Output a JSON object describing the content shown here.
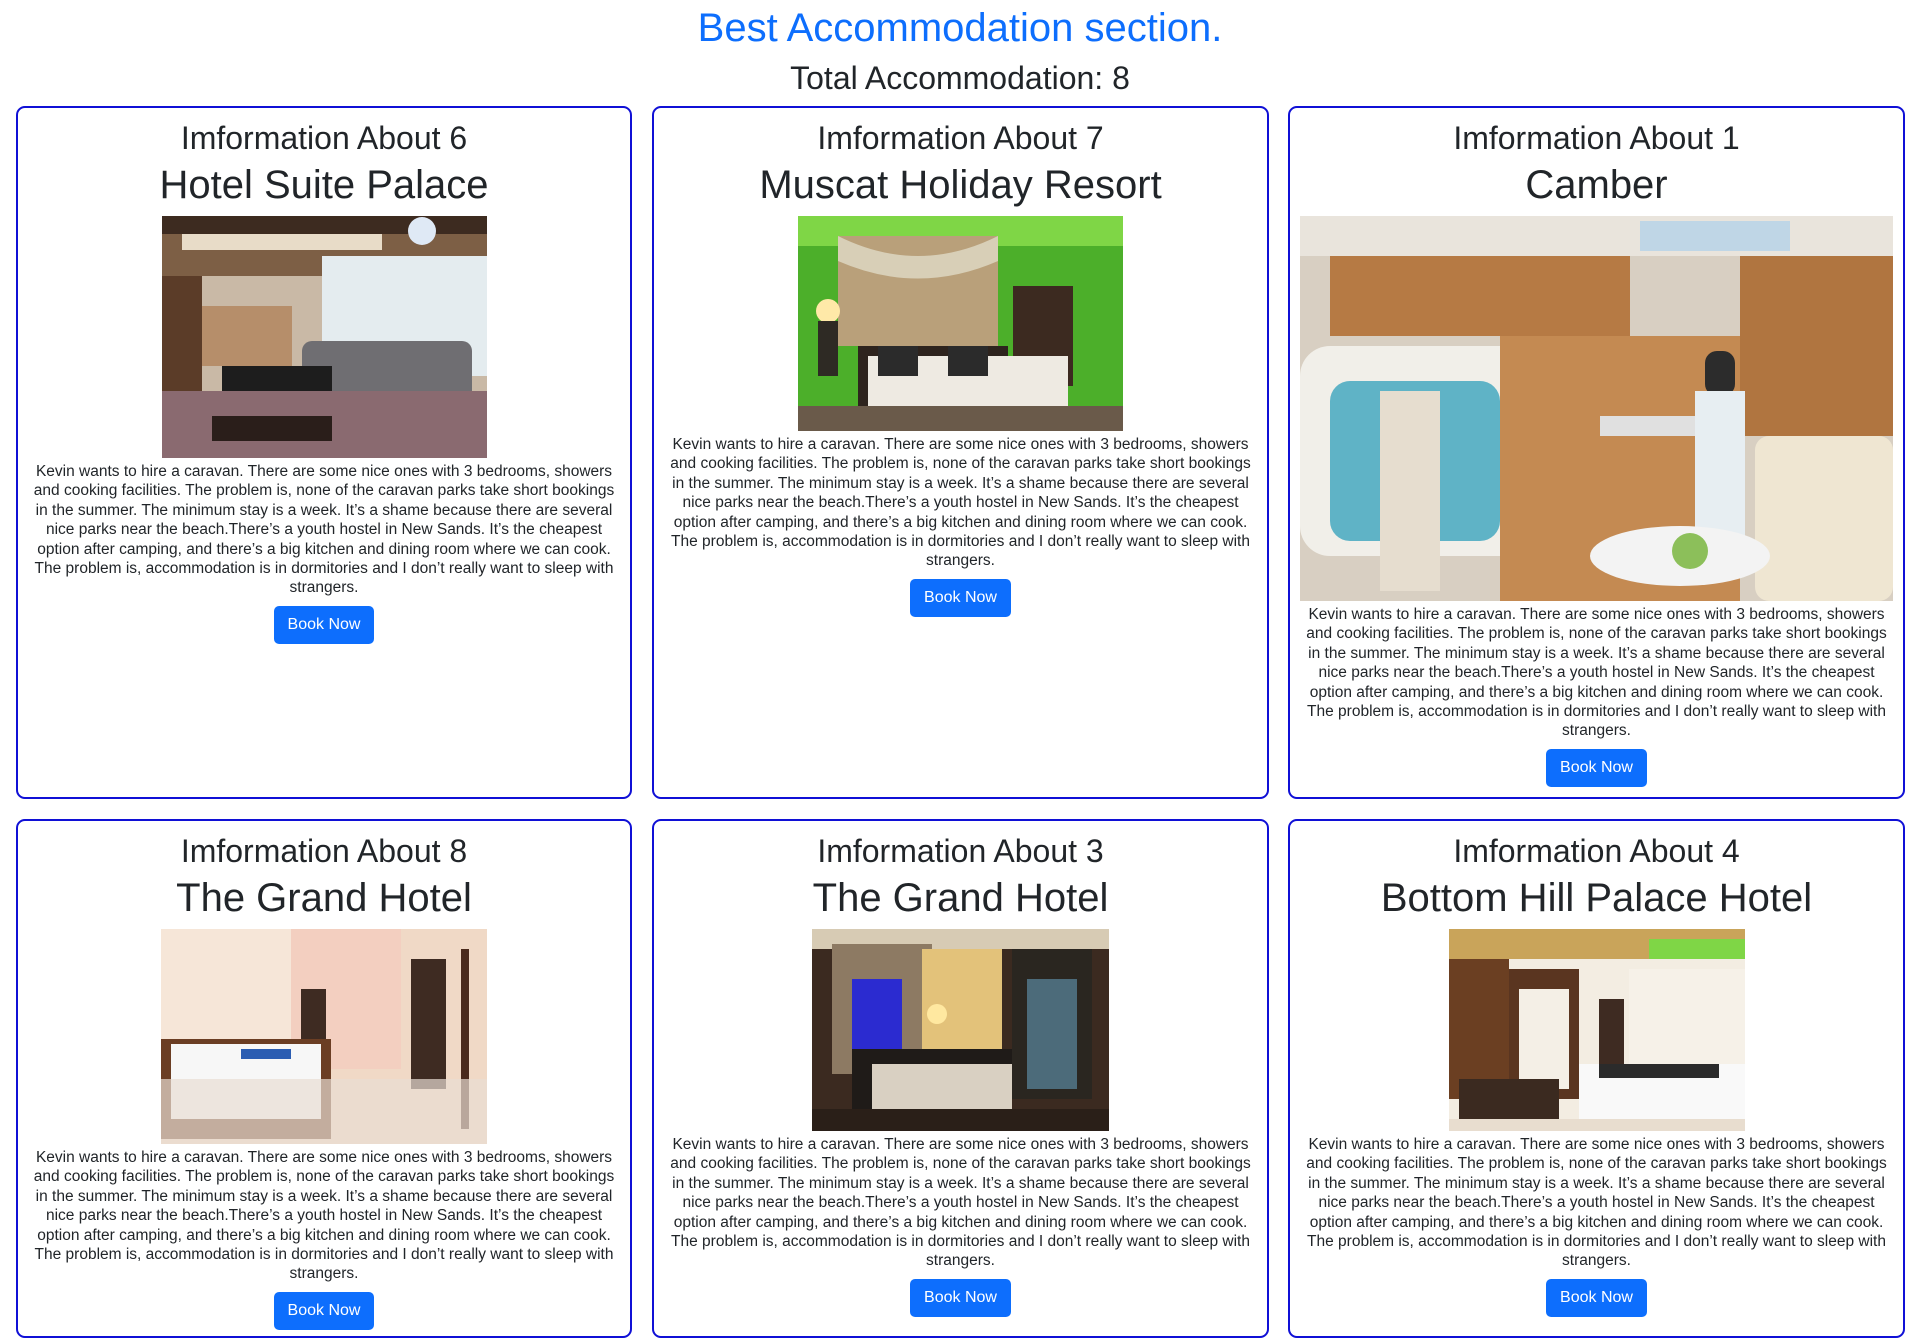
{
  "header": {
    "title": "Best Accommodation section.",
    "total": "Total Accommodation: 8"
  },
  "cards": [
    {
      "info": "Imformation About 6",
      "name": "Hotel Suite Palace",
      "image": "photo of hotel suite living room with sofas",
      "desc": "Kevin wants to hire a caravan. There are some nice ones with 3 bedrooms, showers and cooking facilities. The problem is, none of the caravan parks take short bookings in the summer. The minimum stay is a week. It’s a shame because there are several nice parks near the beach.There’s a youth hostel in New Sands. It’s the cheapest option after camping, and there’s a big kitchen and dining room where we can cook. The problem is, accommodation is in dormitories and I don’t really want to sleep with strangers.",
      "button": "Book Now"
    },
    {
      "info": "Imformation About 7",
      "name": "Muscat Holiday Resort",
      "image": "photo of hotel bedroom with green walls",
      "desc": "Kevin wants to hire a caravan. There are some nice ones with 3 bedrooms, showers and cooking facilities. The problem is, none of the caravan parks take short bookings in the summer. The minimum stay is a week. It’s a shame because there are several nice parks near the beach.There’s a youth hostel in New Sands. It’s the cheapest option after camping, and there’s a big kitchen and dining room where we can cook. The problem is, accommodation is in dormitories and I don’t really want to sleep with strangers.",
      "button": "Book Now"
    },
    {
      "info": "Imformation About 1",
      "name": "Camber",
      "image": "photo of camper van interior with woman cooking",
      "desc": "Kevin wants to hire a caravan. There are some nice ones with 3 bedrooms, showers and cooking facilities. The problem is, none of the caravan parks take short bookings in the summer. The minimum stay is a week. It’s a shame because there are several nice parks near the beach.There’s a youth hostel in New Sands. It’s the cheapest option after camping, and there’s a big kitchen and dining room where we can cook. The problem is, accommodation is in dormitories and I don’t really want to sleep with strangers.",
      "button": "Book Now"
    },
    {
      "info": "Imformation About 8",
      "name": "The Grand Hotel",
      "image": "photo of bright hotel bedroom with double bed",
      "desc": "Kevin wants to hire a caravan. There are some nice ones with 3 bedrooms, showers and cooking facilities. The problem is, none of the caravan parks take short bookings in the summer. The minimum stay is a week. It’s a shame because there are several nice parks near the beach.There’s a youth hostel in New Sands. It’s the cheapest option after camping, and there’s a big kitchen and dining room where we can cook. The problem is, accommodation is in dormitories and I don’t really want to sleep with strangers.",
      "button": "Book Now"
    },
    {
      "info": "Imformation About 3",
      "name": "The Grand Hotel",
      "image": "photo of dim hotel bedroom with curtains",
      "desc": "Kevin wants to hire a caravan. There are some nice ones with 3 bedrooms, showers and cooking facilities. The problem is, none of the caravan parks take short bookings in the summer. The minimum stay is a week. It’s a shame because there are several nice parks near the beach.There’s a youth hostel in New Sands. It’s the cheapest option after camping, and there’s a big kitchen and dining room where we can cook. The problem is, accommodation is in dormitories and I don’t really want to sleep with strangers.",
      "button": "Book Now"
    },
    {
      "info": "Imformation About 4",
      "name": "Bottom Hill Palace Hotel",
      "image": "photo of hotel room with patterned bedspread",
      "desc": "Kevin wants to hire a caravan. There are some nice ones with 3 bedrooms, showers and cooking facilities. The problem is, none of the caravan parks take short bookings in the summer. The minimum stay is a week. It’s a shame because there are several nice parks near the beach.There’s a youth hostel in New Sands. It’s the cheapest option after camping, and there’s a big kitchen and dining room where we can cook. The problem is, accommodation is in dormitories and I don’t really want to sleep with strangers.",
      "button": "Book Now"
    }
  ],
  "colors": {
    "accent": "#0d6efd",
    "card_border": "#1010d6",
    "text": "#212529"
  }
}
